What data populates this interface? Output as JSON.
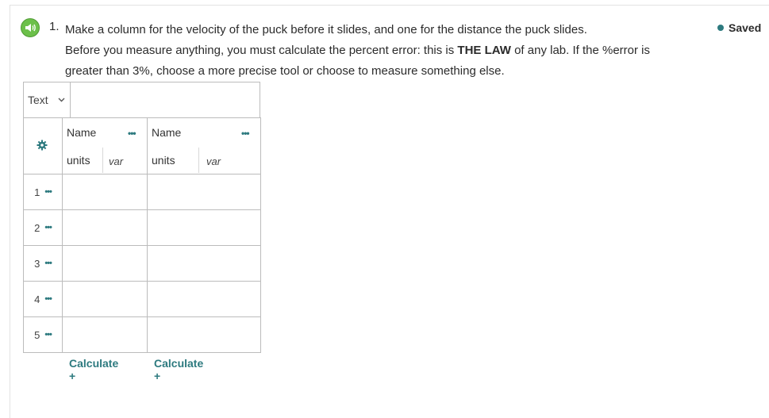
{
  "question": {
    "number": "1.",
    "line1": "Make a column for the velocity of the puck before it slides, and one for the distance the puck slides.",
    "line2_pre": "Before you measure anything, you must calculate the percent error: this is",
    "line2_bold": "THE LAW",
    "line2_post": "of any lab. If the %error is",
    "line3": "greater than 3%, choose a more precise tool or choose to measure something else."
  },
  "status": {
    "label": "Saved",
    "color": "#2d7a7f"
  },
  "table": {
    "type_select": "Text",
    "columns": [
      {
        "name": "Name",
        "units": "units",
        "var": "var",
        "calculate": "Calculate +"
      },
      {
        "name": "Name",
        "units": "units",
        "var": "var",
        "calculate": "Calculate +"
      }
    ],
    "rows": [
      "1",
      "2",
      "3",
      "4",
      "5"
    ],
    "more_glyph": "•••"
  },
  "icons": {
    "speaker": "speaker-icon",
    "gear": "gear-icon",
    "chevron": "chevron-down-icon"
  }
}
